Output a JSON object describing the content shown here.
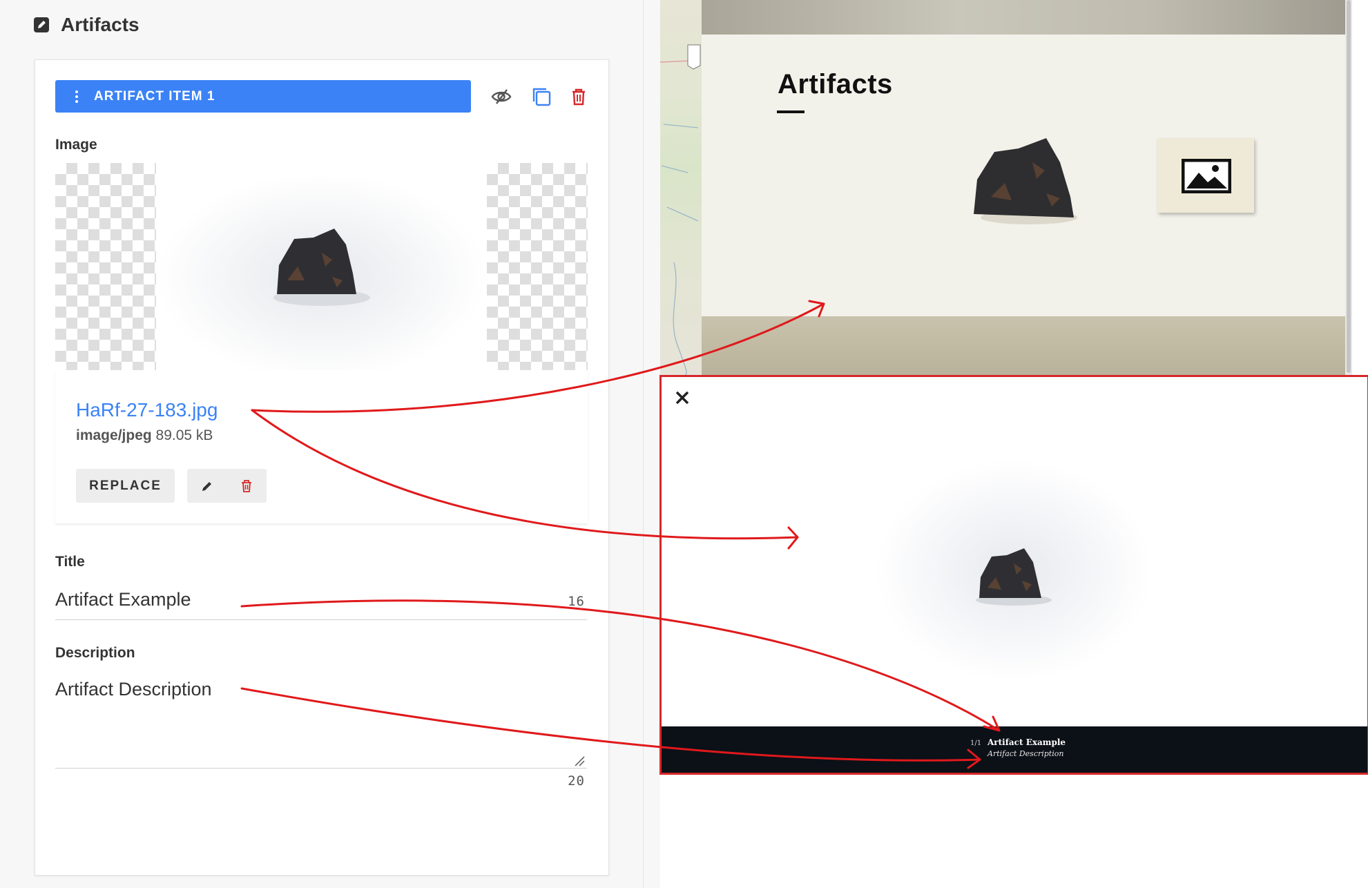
{
  "section": {
    "title": "Artifacts",
    "icon": "edit-square-icon"
  },
  "artifact_item": {
    "label": "ARTIFACT ITEM 1",
    "actions": [
      "visibility-off-icon",
      "duplicate-icon",
      "delete-icon"
    ]
  },
  "image_field": {
    "label": "Image",
    "file_name": "HaRf-27-183.jpg",
    "mime_type": "image/jpeg",
    "size": "89.05 kB",
    "replace_label": "REPLACE",
    "actions": [
      "pencil-icon",
      "trash-icon"
    ]
  },
  "title_field": {
    "label": "Title",
    "value": "Artifact Example",
    "count": "16"
  },
  "description_field": {
    "label": "Description",
    "value": "Artifact Description",
    "count": "20"
  },
  "preview": {
    "page_title": "Artifacts",
    "lightbox": {
      "counter": "1/1",
      "caption_title": "Artifact Example",
      "caption_description": "Artifact Description"
    }
  },
  "colors": {
    "accent": "#3b82f6",
    "danger": "#d62728",
    "caption_bg": "#0c1017"
  }
}
